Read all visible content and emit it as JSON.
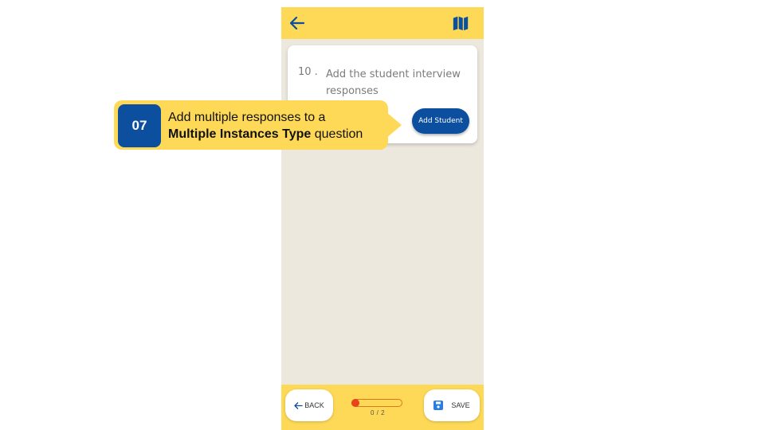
{
  "question": {
    "number": "10 .",
    "text": "Add the student interview responses",
    "add_button_label": "Add Student"
  },
  "bottom_bar": {
    "back_label": "BACK",
    "save_label": "SAVE",
    "progress_text": "0 / 2",
    "progress_fraction": 0.0
  },
  "tutorial": {
    "step": "07",
    "text_prefix": "Add multiple responses to a",
    "text_bold": "Multiple Instances Type",
    "text_suffix": " question"
  },
  "colors": {
    "brand_yellow": "#fed957",
    "brand_blue": "#0b4f9e",
    "progress_red": "#e8431c",
    "background": "#ece8de"
  },
  "icons": {
    "back": "arrow-left-icon",
    "map": "map-icon",
    "save": "floppy-disk-icon"
  }
}
